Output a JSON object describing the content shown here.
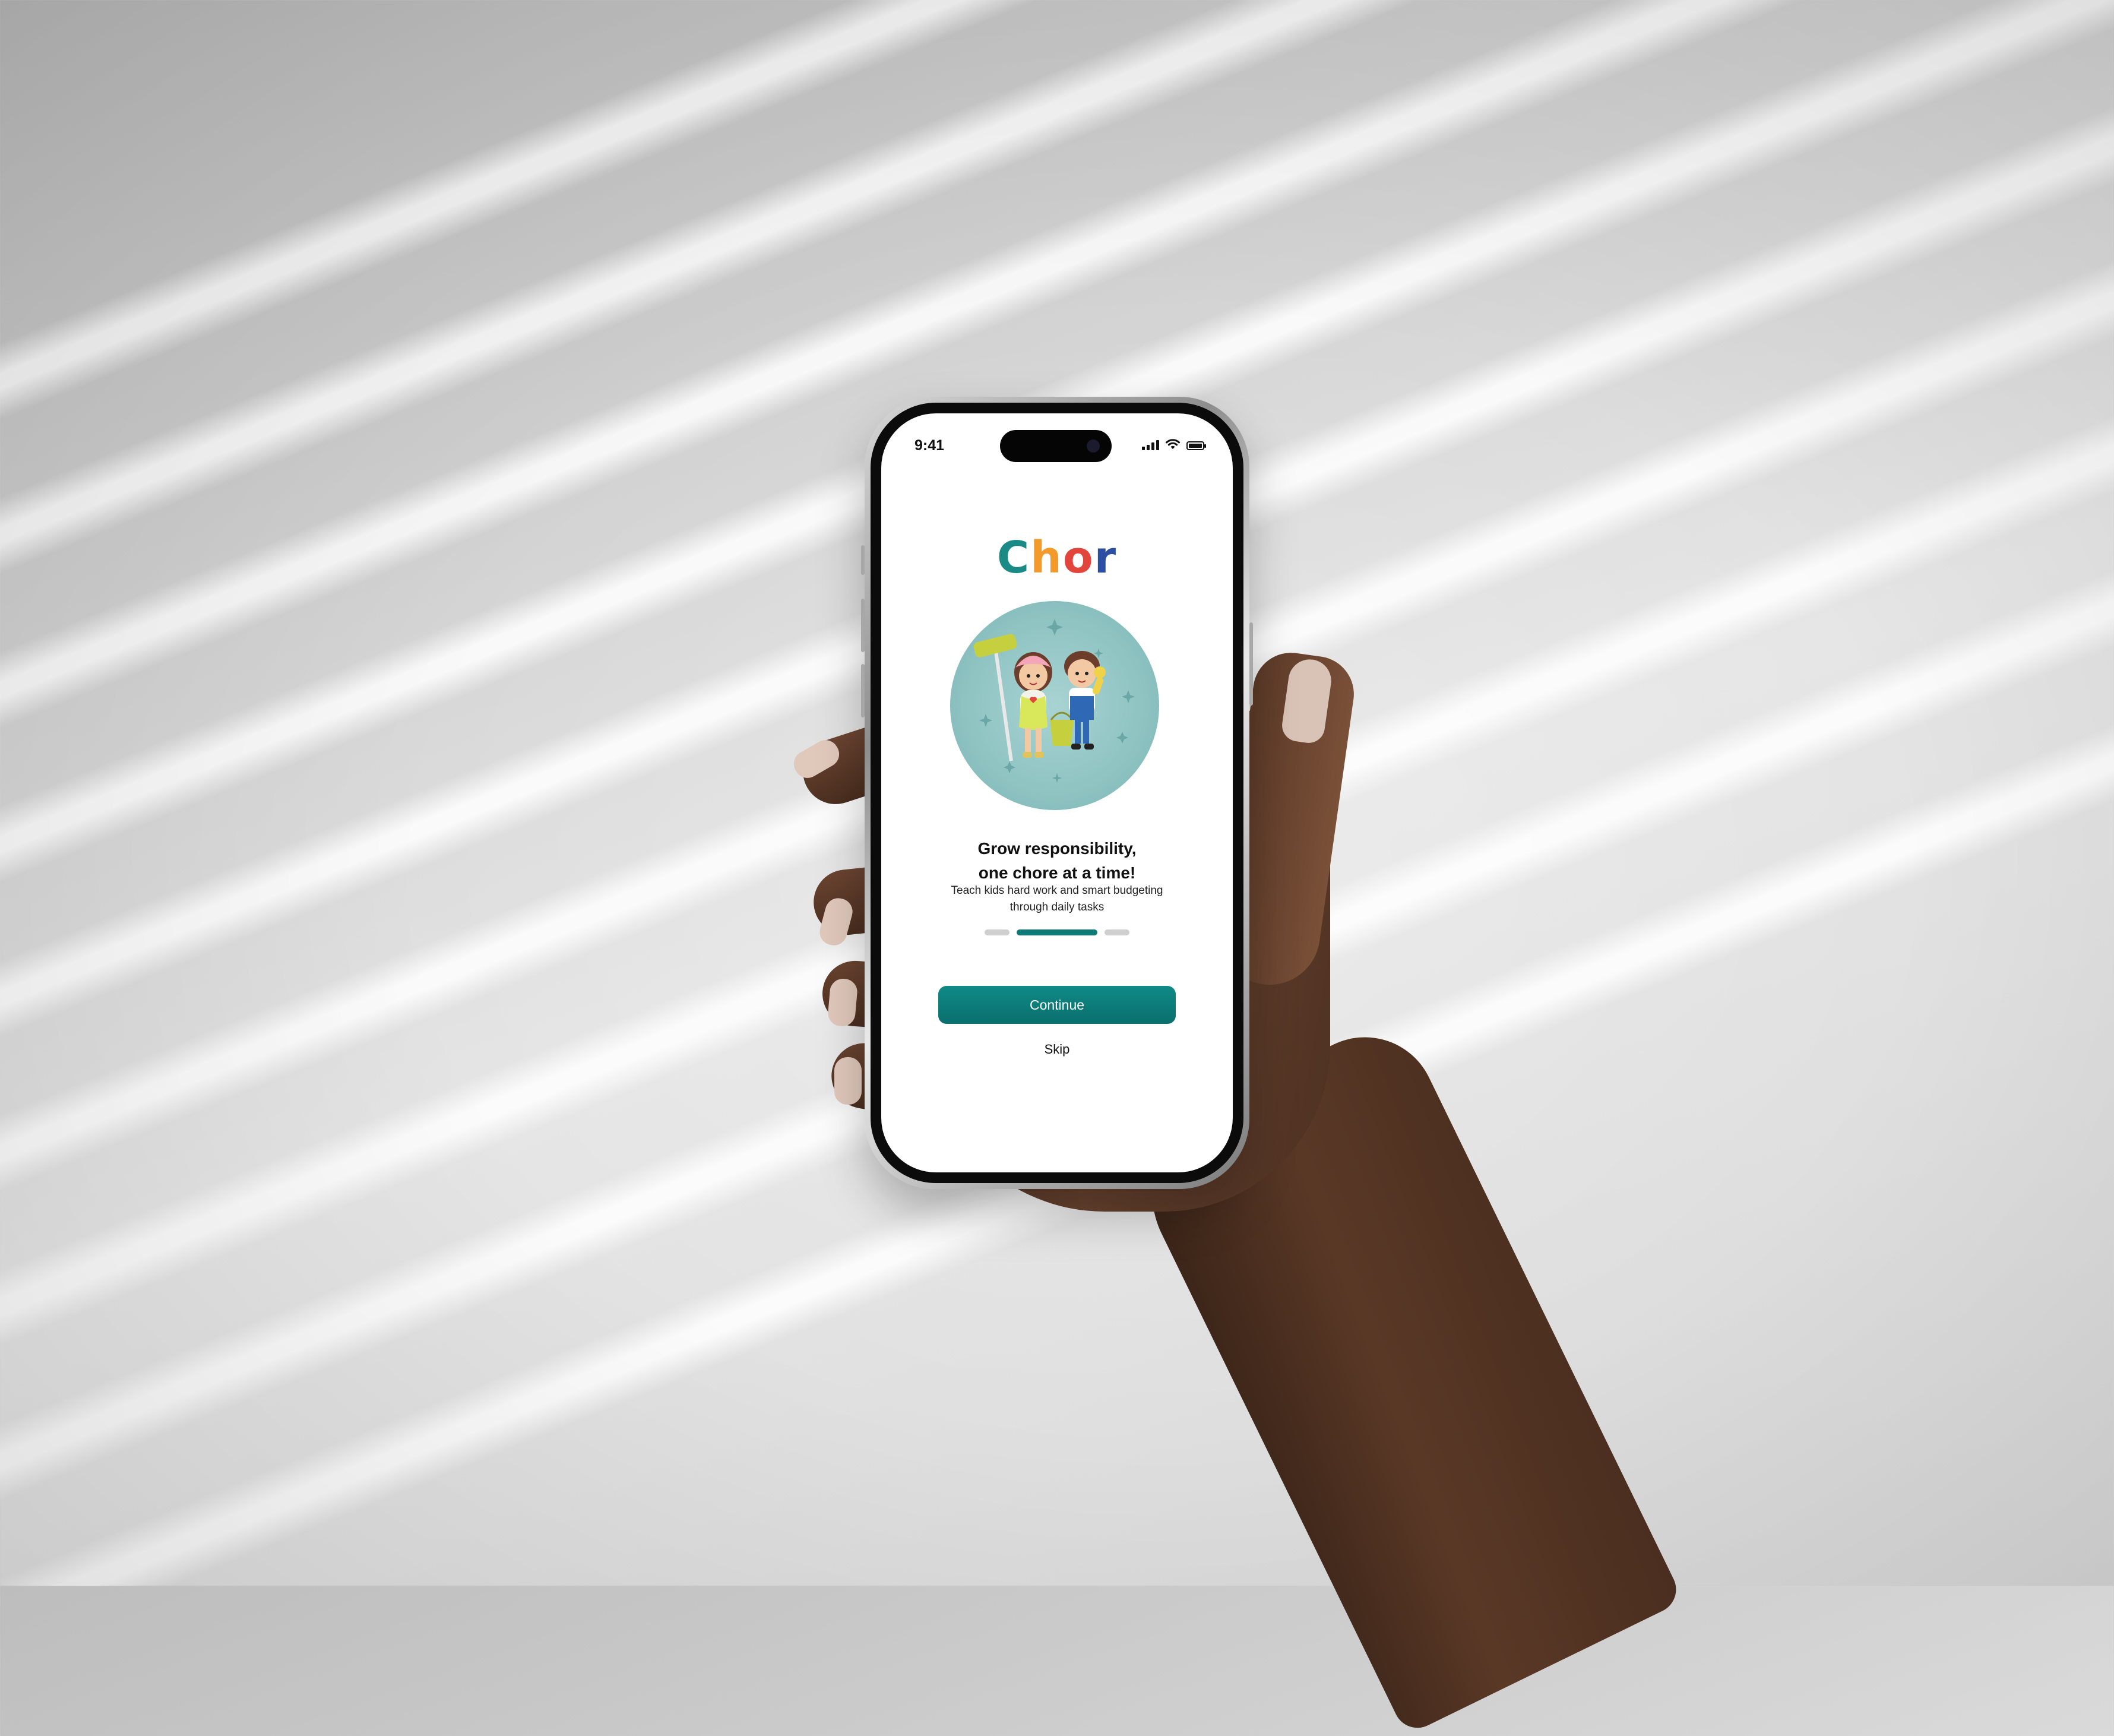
{
  "app": {
    "logo_letters": [
      {
        "char": "C",
        "color": "#1a8a86"
      },
      {
        "char": "h",
        "color": "#f29b2b"
      },
      {
        "char": "o",
        "color": "#e2453b"
      },
      {
        "char": "r",
        "color": "#2c4fa3"
      }
    ]
  },
  "statusbar": {
    "time": "9:41",
    "icons": [
      "signal-icon",
      "wifi-icon",
      "battery-icon"
    ]
  },
  "onboarding": {
    "title_line1": "Grow responsibility,",
    "title_line2": "one chore at a time!",
    "subtitle_line1": "Teach kids hard work and smart budgeting",
    "subtitle_line2": "through daily tasks",
    "page_count": 3,
    "active_page": 2,
    "continue_label": "Continue",
    "skip_label": "Skip"
  },
  "colors": {
    "accent": "#0e7a78",
    "hero_bg": "#8ec3c2"
  }
}
